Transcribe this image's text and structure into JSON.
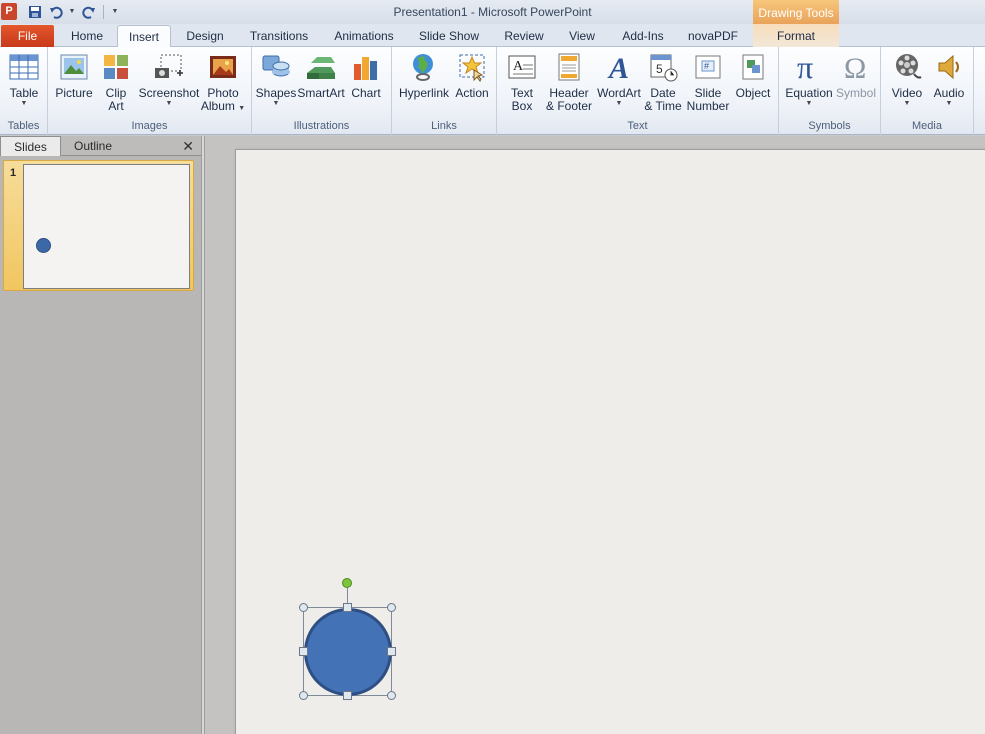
{
  "title_bar": {
    "app_letter": "P",
    "title": "Presentation1 - Microsoft PowerPoint",
    "context_header": "Drawing Tools"
  },
  "tabs": {
    "file": "File",
    "items": [
      "Home",
      "Insert",
      "Design",
      "Transitions",
      "Animations",
      "Slide Show",
      "Review",
      "View",
      "Add-Ins",
      "novaPDF",
      "Format"
    ],
    "active": "Insert"
  },
  "ribbon": {
    "groups": {
      "tables": "Tables",
      "images": "Images",
      "illustrations": "Illustrations",
      "links": "Links",
      "text": "Text",
      "symbols": "Symbols",
      "media": "Media"
    },
    "buttons": {
      "table": "Table",
      "picture": "Picture",
      "clip_art_1": "Clip",
      "clip_art_2": "Art",
      "screenshot": "Screenshot",
      "photo_album_1": "Photo",
      "photo_album_2": "Album",
      "shapes": "Shapes",
      "smartart": "SmartArt",
      "chart": "Chart",
      "hyperlink": "Hyperlink",
      "action": "Action",
      "text_box_1": "Text",
      "text_box_2": "Box",
      "header_footer_1": "Header",
      "header_footer_2": "& Footer",
      "wordart": "WordArt",
      "date_time_1": "Date",
      "date_time_2": "& Time",
      "slide_number_1": "Slide",
      "slide_number_2": "Number",
      "object": "Object",
      "equation": "Equation",
      "symbol": "Symbol",
      "video": "Video",
      "audio": "Audio"
    }
  },
  "slides_pane": {
    "tab_slides": "Slides",
    "tab_outline": "Outline",
    "close": "✕",
    "thumbnails": [
      {
        "number": "1"
      }
    ]
  },
  "colors": {
    "accent": "#c8391a",
    "shape_fill": "#4472b6",
    "shape_border": "#2e4f84",
    "context_tab": "#eaa25a"
  }
}
